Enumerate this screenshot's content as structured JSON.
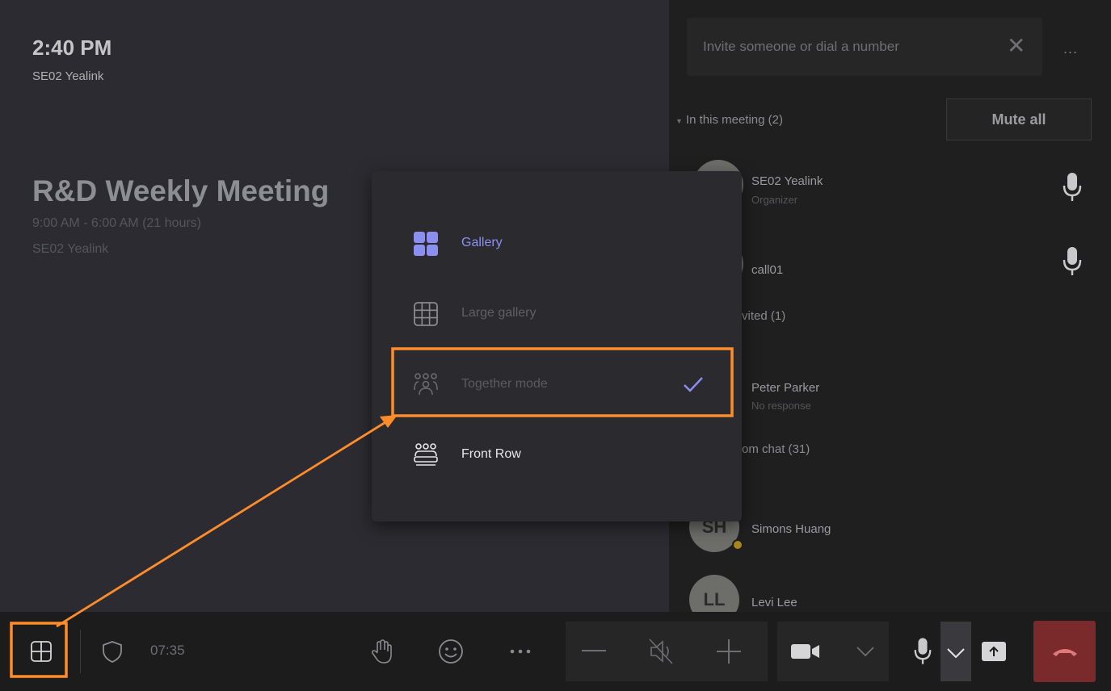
{
  "meeting": {
    "clock": "2:40 PM",
    "device": "SE02 Yealink",
    "title": "R&D Weekly Meeting",
    "time_range": "9:00 AM - 6:00 AM (21 hours)",
    "organizer": "SE02 Yealink"
  },
  "panel": {
    "invite_placeholder": "Invite someone or dial a number",
    "more_label": "...",
    "in_meeting_label": "In this meeting (2)",
    "mute_all_label": "Mute all",
    "participants": [
      {
        "name": "SE02 Yealink",
        "role": "Organizer"
      },
      {
        "name": "call01",
        "role": ""
      }
    ],
    "invited_label": "vited (1)",
    "invited": [
      {
        "name": "Peter Parker",
        "status": "No response"
      }
    ],
    "chat_label": "om chat (31)",
    "chat_members": [
      {
        "initials": "SH",
        "name": "Simons Huang"
      },
      {
        "initials": "LL",
        "name": "Levi Lee"
      }
    ]
  },
  "layout_menu": {
    "items": [
      {
        "label": "Gallery",
        "icon": "gallery-icon",
        "state": "active"
      },
      {
        "label": "Large gallery",
        "icon": "large-gallery-icon",
        "state": "disabled"
      },
      {
        "label": "Together mode",
        "icon": "together-mode-icon",
        "state": "selected"
      },
      {
        "label": "Front Row",
        "icon": "front-row-icon",
        "state": "normal"
      }
    ],
    "accent_color": "#7b7fe6",
    "highlight_color": "#ff8c2b"
  },
  "toolbar": {
    "timer": "07:35",
    "icons": [
      "layout-icon",
      "shield-icon",
      "raise-hand-icon",
      "reactions-icon",
      "more-icon",
      "volume-down-icon",
      "speaker-muted-icon",
      "volume-up-icon",
      "camera-icon",
      "chevron-down-icon",
      "microphone-icon",
      "chevron-down-icon",
      "share-icon",
      "hang-up-icon"
    ]
  }
}
